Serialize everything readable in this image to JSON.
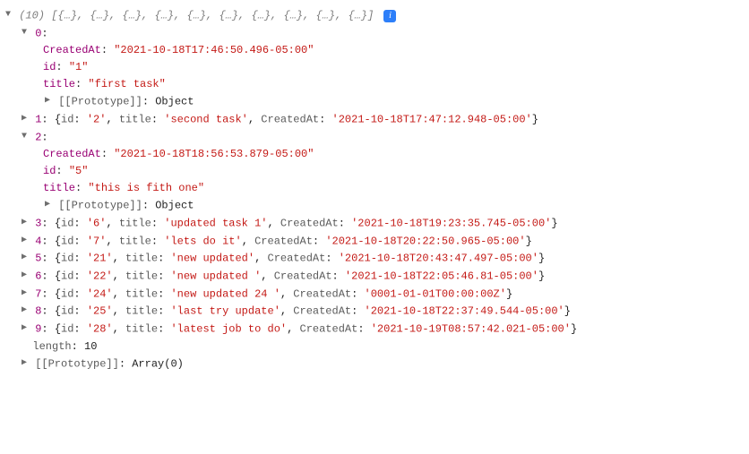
{
  "header": {
    "count": "(10)",
    "summary": "[{…}, {…}, {…}, {…}, {…}, {…}, {…}, {…}, {…}, {…}]",
    "info_glyph": "i"
  },
  "items": [
    {
      "expanded": true,
      "index": "0",
      "props": {
        "CreatedAt": "\"2021-10-18T17:46:50.496-05:00\"",
        "id": "\"1\"",
        "title": "\"first task\""
      },
      "proto_label": "[[Prototype]]",
      "proto_value": "Object"
    },
    {
      "expanded": false,
      "index": "1",
      "inline": "{id: '2', title: 'second task', CreatedAt: '2021-10-18T17:47:12.948-05:00'}"
    },
    {
      "expanded": true,
      "index": "2",
      "props": {
        "CreatedAt": "\"2021-10-18T18:56:53.879-05:00\"",
        "id": "\"5\"",
        "title": "\"this is fith one\""
      },
      "proto_label": "[[Prototype]]",
      "proto_value": "Object"
    },
    {
      "expanded": false,
      "index": "3",
      "inline": "{id: '6', title: 'updated task 1', CreatedAt: '2021-10-18T19:23:35.745-05:00'}"
    },
    {
      "expanded": false,
      "index": "4",
      "inline": "{id: '7', title: 'lets do it', CreatedAt: '2021-10-18T20:22:50.965-05:00'}"
    },
    {
      "expanded": false,
      "index": "5",
      "inline": "{id: '21', title: 'new updated', CreatedAt: '2021-10-18T20:43:47.497-05:00'}"
    },
    {
      "expanded": false,
      "index": "6",
      "inline": "{id: '22', title: 'new updated ', CreatedAt: '2021-10-18T22:05:46.81-05:00'}"
    },
    {
      "expanded": false,
      "index": "7",
      "inline": "{id: '24', title: 'new updated 24 ', CreatedAt: '0001-01-01T00:00:00Z'}"
    },
    {
      "expanded": false,
      "index": "8",
      "inline": "{id: '25', title: 'last try update', CreatedAt: '2021-10-18T22:37:49.544-05:00'}"
    },
    {
      "expanded": false,
      "index": "9",
      "inline": "{id: '28', title: 'latest job to do', CreatedAt: '2021-10-19T08:57:42.021-05:00'}"
    }
  ],
  "length_label": "length",
  "length_value": "10",
  "array_proto_label": "[[Prototype]]",
  "array_proto_value": "Array(0)"
}
